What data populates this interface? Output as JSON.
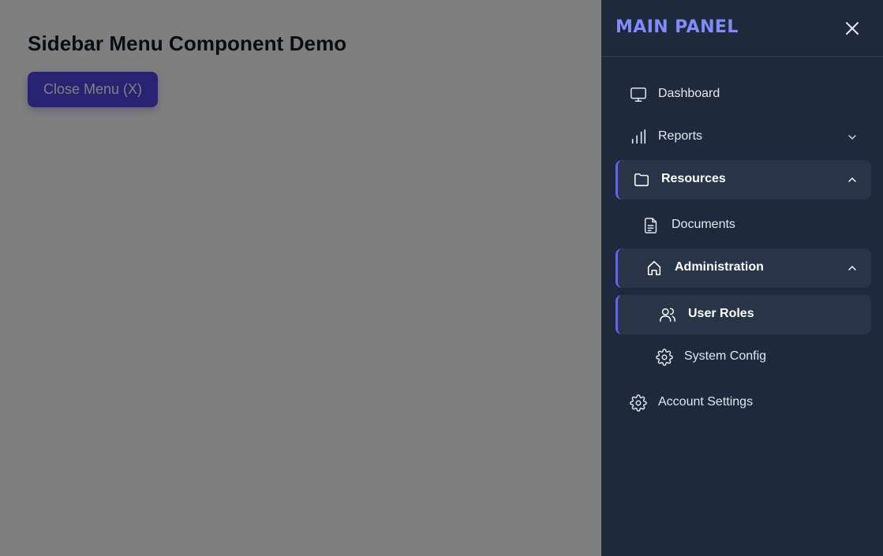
{
  "page": {
    "title": "Sidebar Menu Component Demo",
    "close_menu_label": "Close Menu (X)"
  },
  "sidebar": {
    "brand": "MAIN PANEL",
    "close_icon": "close-icon",
    "items": [
      {
        "label": "Dashboard",
        "icon": "monitor-icon",
        "active": false
      },
      {
        "label": "Reports",
        "icon": "bar-chart-icon",
        "expandable": true,
        "expanded": false
      },
      {
        "label": "Resources",
        "icon": "folder-icon",
        "expandable": true,
        "expanded": true,
        "active": true
      },
      {
        "label": "Documents",
        "icon": "document-icon",
        "level": 1
      },
      {
        "label": "Administration",
        "icon": "home-icon",
        "expandable": true,
        "expanded": true,
        "active": true,
        "level": 1
      },
      {
        "label": "User Roles",
        "icon": "users-icon",
        "active": true,
        "level": 2
      },
      {
        "label": "System Config",
        "icon": "gear-icon",
        "level": 2
      },
      {
        "label": "Account Settings",
        "icon": "gear-icon"
      }
    ]
  },
  "colors": {
    "accent": "#6366f1",
    "brand": "#818cf8",
    "sidebar_bg": "#1e293b",
    "active_bg": "#283548",
    "button_bg": "#4f46e5"
  }
}
